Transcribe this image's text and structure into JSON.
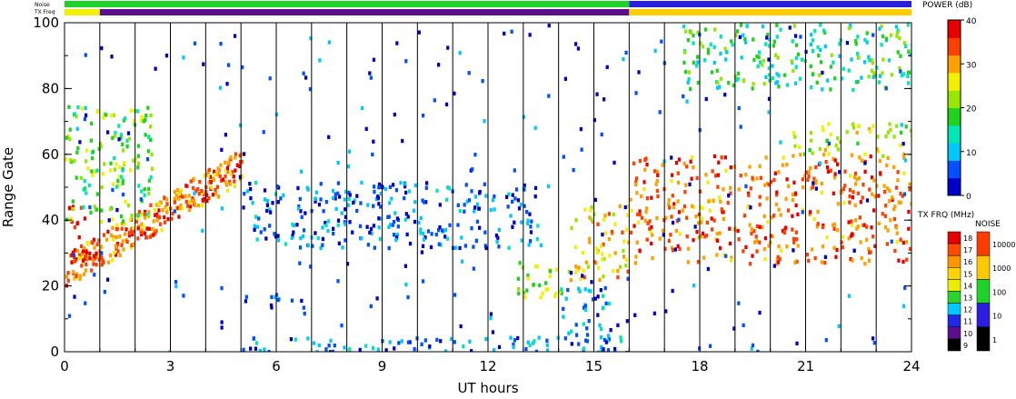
{
  "chart_data": {
    "type": "heatmap",
    "title": "",
    "xlabel": "UT hours",
    "ylabel": "Range Gate",
    "xlim": [
      0,
      24
    ],
    "ylim": [
      0,
      100
    ],
    "x_ticks": [
      "0",
      "3",
      "6",
      "9",
      "12",
      "15",
      "18",
      "21",
      "24"
    ],
    "y_ticks": [
      "0",
      "20",
      "40",
      "60",
      "80",
      "100"
    ],
    "grid": "vertical lines every hour",
    "strips": [
      {
        "label": "Noise",
        "segments": [
          {
            "x0": 0,
            "x1": 16,
            "level": "100",
            "color": "#1fd22a"
          },
          {
            "x0": 16,
            "x1": 24,
            "level": "10",
            "color": "#2a1ee0"
          }
        ]
      },
      {
        "label": "TX Freq",
        "segments": [
          {
            "x0": 0,
            "x1": 1,
            "freq": 14,
            "color": "#f0f000"
          },
          {
            "x0": 1,
            "x1": 16,
            "freq": 10,
            "color": "#5a0f8c"
          },
          {
            "x0": 16,
            "x1": 24,
            "freq": 15,
            "color": "#ffcc00"
          }
        ]
      }
    ],
    "echo_regions": [
      {
        "t0": 0.0,
        "t1": 5.0,
        "g0": 22,
        "g1": 60,
        "power_db": 32,
        "note": "rising band from 25 to 60"
      },
      {
        "t0": 0.0,
        "t1": 0.9,
        "g0": 28,
        "g1": 45,
        "power_db": 38
      },
      {
        "t0": 0.0,
        "t1": 2.5,
        "g0": 40,
        "g1": 75,
        "power_db": 20
      },
      {
        "t0": 5.0,
        "t1": 13.5,
        "g0": 32,
        "g1": 52,
        "power_db": 7
      },
      {
        "t0": 5.0,
        "t1": 16.0,
        "g0": 0,
        "g1": 5,
        "power_db": 8
      },
      {
        "t0": 5.8,
        "t1": 6.8,
        "g0": 13,
        "g1": 18,
        "power_db": 5
      },
      {
        "t0": 12.8,
        "t1": 14.6,
        "g0": 17,
        "g1": 28,
        "power_db": 22
      },
      {
        "t0": 14.0,
        "t1": 15.5,
        "g0": 5,
        "g1": 20,
        "power_db": 8
      },
      {
        "t0": 14.3,
        "t1": 16.0,
        "g0": 22,
        "g1": 45,
        "power_db": 28
      },
      {
        "t0": 16.0,
        "t1": 24.0,
        "g0": 27,
        "g1": 60,
        "power_db": 33,
        "note": "strong red band near gates 30-38"
      },
      {
        "t0": 20.5,
        "t1": 24.0,
        "g0": 60,
        "g1": 70,
        "power_db": 24
      },
      {
        "t0": 17.5,
        "t1": 24.0,
        "g0": 80,
        "g1": 100,
        "power_db": 16
      }
    ],
    "power_colorbar": {
      "title": "POWER (dB)",
      "ticks": [
        "0",
        "10",
        "20",
        "30",
        "40"
      ],
      "range": [
        0,
        40
      ],
      "colors": [
        "#0000c8",
        "#0050ff",
        "#00c8ff",
        "#00e6b4",
        "#1ed21e",
        "#96e600",
        "#f0f000",
        "#ffa000",
        "#ff4000",
        "#e60000"
      ]
    },
    "txfreq_colorbar": {
      "title": "TX FRQ (MHz)",
      "labels": [
        "18",
        "17",
        "16",
        "15",
        "14",
        "13",
        "12",
        "11",
        "10",
        "9"
      ],
      "colors": [
        "#e60000",
        "#ff4a00",
        "#ff9600",
        "#ffd200",
        "#e8f000",
        "#2ad42a",
        "#00c8ff",
        "#1e28e6",
        "#5a0f8c",
        "#000000"
      ]
    },
    "noise_colorbar": {
      "title": "NOISE",
      "labels": [
        "10000",
        "1000",
        "100",
        "10",
        "1"
      ],
      "colors": [
        "#ff3c00",
        "#ffc800",
        "#1fd22a",
        "#2a1ee0",
        "#000000"
      ]
    }
  }
}
